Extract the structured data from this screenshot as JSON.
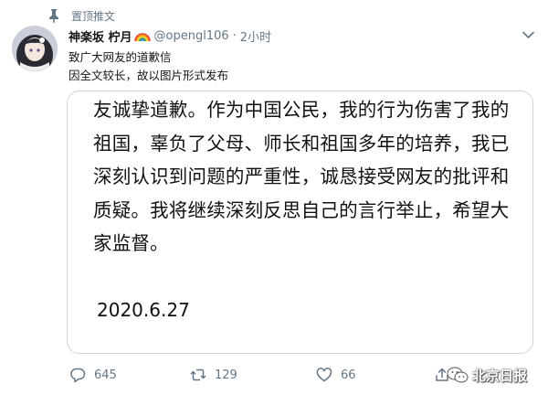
{
  "pinned": {
    "label": "置顶推文"
  },
  "author": {
    "display_name": "神楽坂 柠月",
    "handle": "@opengl106",
    "separator": "·",
    "time": "2小时"
  },
  "tweet": {
    "lines": [
      "致广大网友的道歉信",
      "因全文较长，故以图片形式发布"
    ]
  },
  "letter": {
    "text": "友诚挚道歉。作为中国公民，我的行为伤害了我的祖国，辜负了父母、师长和祖国多年的培养，我已深刻认识到问题的严重性，诚恳接受网友的批评和质疑。我将继续深刻反思自己的言行举止，希望大家监督。",
    "date": "2020.6.27"
  },
  "actions": {
    "reply_count": "645",
    "retweet_count": "129",
    "like_count": "66"
  },
  "watermark": {
    "text": "北京日报"
  },
  "colors": {
    "secondary_text": "#657786",
    "border": "#ccd6dd",
    "text": "#14171a"
  },
  "icons": [
    "pin-icon",
    "rainbow-icon",
    "chevron-down-icon",
    "reply-icon",
    "retweet-icon",
    "like-icon",
    "share-icon"
  ]
}
